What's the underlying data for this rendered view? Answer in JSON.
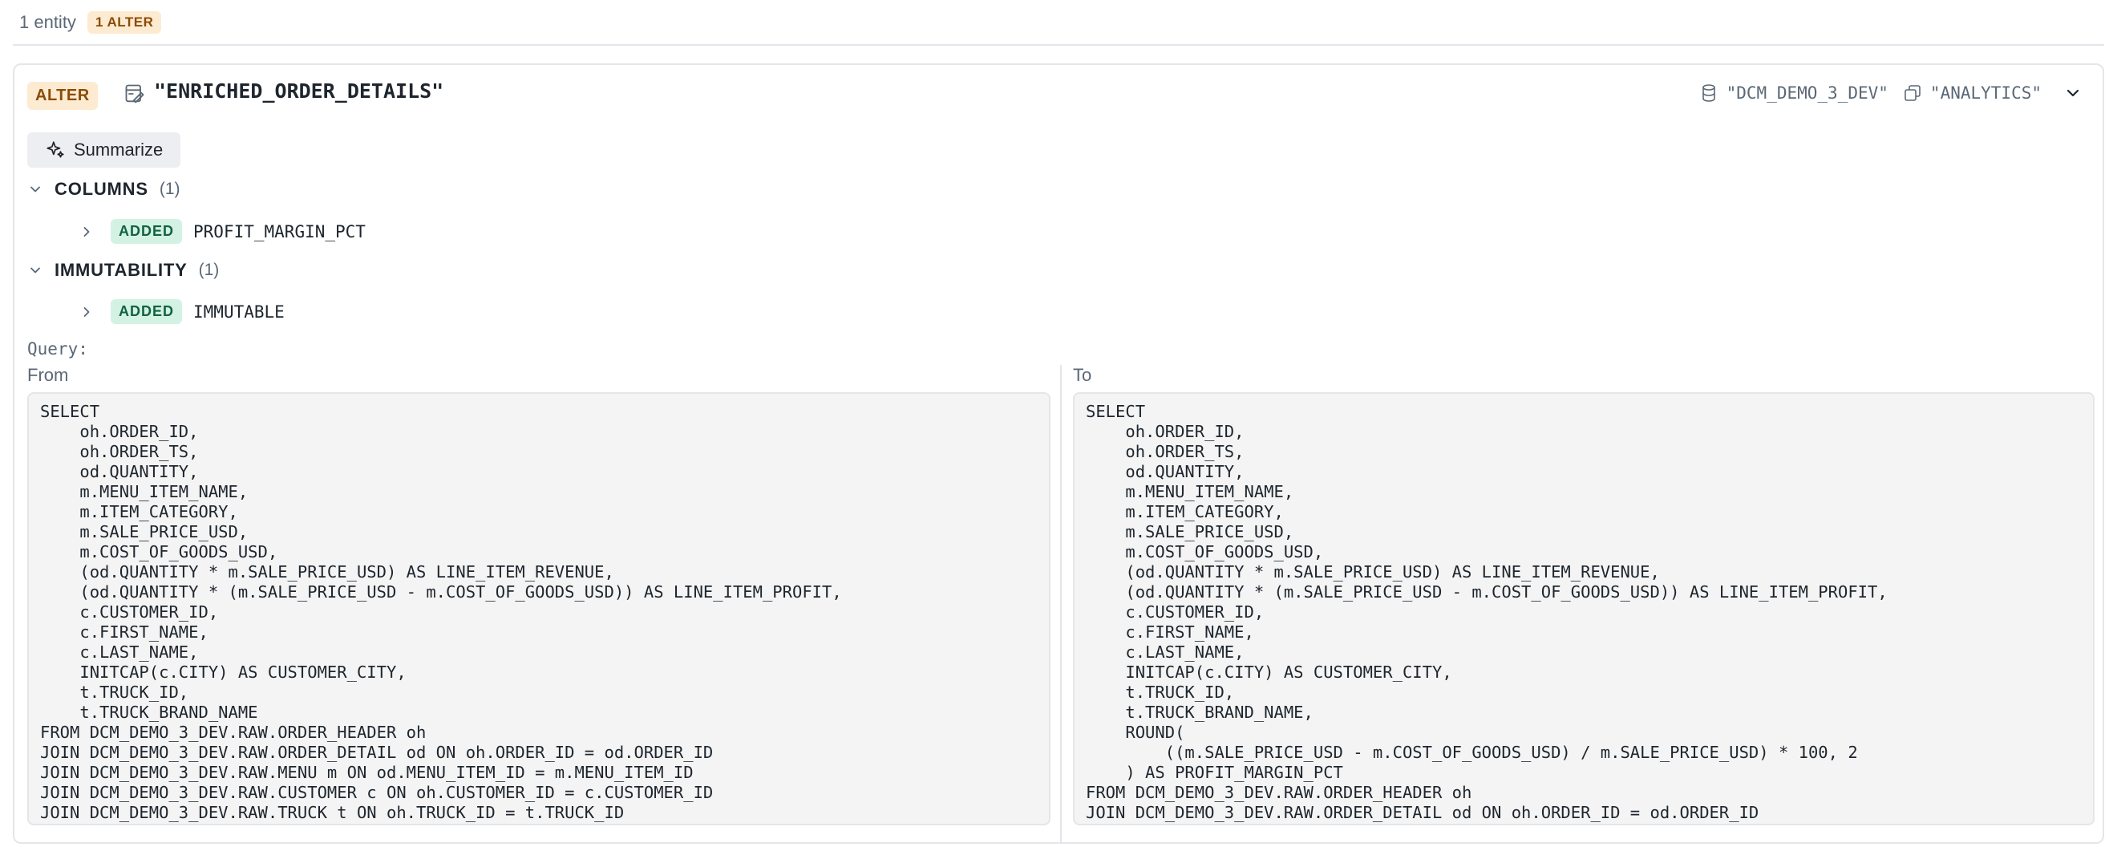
{
  "topbar": {
    "count_text": "1 entity",
    "badge": "1 ALTER"
  },
  "entity": {
    "action": "ALTER",
    "name": "\"ENRICHED_ORDER_DETAILS\"",
    "database": "\"DCM_DEMO_3_DEV\"",
    "schema": "\"ANALYTICS\""
  },
  "summarize_label": "Summarize",
  "sections": {
    "columns": {
      "title": "COLUMNS",
      "count": "(1)",
      "item": {
        "badge": "ADDED",
        "name": "PROFIT_MARGIN_PCT"
      }
    },
    "immutability": {
      "title": "IMMUTABILITY",
      "count": "(1)",
      "item": {
        "badge": "ADDED",
        "name": "IMMUTABLE"
      }
    }
  },
  "query": {
    "label": "Query:",
    "from_label": "From",
    "to_label": "To",
    "from_sql": "SELECT\n    oh.ORDER_ID,\n    oh.ORDER_TS,\n    od.QUANTITY,\n    m.MENU_ITEM_NAME,\n    m.ITEM_CATEGORY,\n    m.SALE_PRICE_USD,\n    m.COST_OF_GOODS_USD,\n    (od.QUANTITY * m.SALE_PRICE_USD) AS LINE_ITEM_REVENUE,\n    (od.QUANTITY * (m.SALE_PRICE_USD - m.COST_OF_GOODS_USD)) AS LINE_ITEM_PROFIT,\n    c.CUSTOMER_ID,\n    c.FIRST_NAME,\n    c.LAST_NAME,\n    INITCAP(c.CITY) AS CUSTOMER_CITY,\n    t.TRUCK_ID,\n    t.TRUCK_BRAND_NAME\nFROM DCM_DEMO_3_DEV.RAW.ORDER_HEADER oh\nJOIN DCM_DEMO_3_DEV.RAW.ORDER_DETAIL od ON oh.ORDER_ID = od.ORDER_ID\nJOIN DCM_DEMO_3_DEV.RAW.MENU m ON od.MENU_ITEM_ID = m.MENU_ITEM_ID\nJOIN DCM_DEMO_3_DEV.RAW.CUSTOMER c ON oh.CUSTOMER_ID = c.CUSTOMER_ID\nJOIN DCM_DEMO_3_DEV.RAW.TRUCK t ON oh.TRUCK_ID = t.TRUCK_ID",
    "to_sql": "SELECT\n    oh.ORDER_ID,\n    oh.ORDER_TS,\n    od.QUANTITY,\n    m.MENU_ITEM_NAME,\n    m.ITEM_CATEGORY,\n    m.SALE_PRICE_USD,\n    m.COST_OF_GOODS_USD,\n    (od.QUANTITY * m.SALE_PRICE_USD) AS LINE_ITEM_REVENUE,\n    (od.QUANTITY * (m.SALE_PRICE_USD - m.COST_OF_GOODS_USD)) AS LINE_ITEM_PROFIT,\n    c.CUSTOMER_ID,\n    c.FIRST_NAME,\n    c.LAST_NAME,\n    INITCAP(c.CITY) AS CUSTOMER_CITY,\n    t.TRUCK_ID,\n    t.TRUCK_BRAND_NAME,\n    ROUND(\n        ((m.SALE_PRICE_USD - m.COST_OF_GOODS_USD) / m.SALE_PRICE_USD) * 100, 2\n    ) AS PROFIT_MARGIN_PCT\nFROM DCM_DEMO_3_DEV.RAW.ORDER_HEADER oh\nJOIN DCM_DEMO_3_DEV.RAW.ORDER_DETAIL od ON oh.ORDER_ID = od.ORDER_ID"
  }
}
